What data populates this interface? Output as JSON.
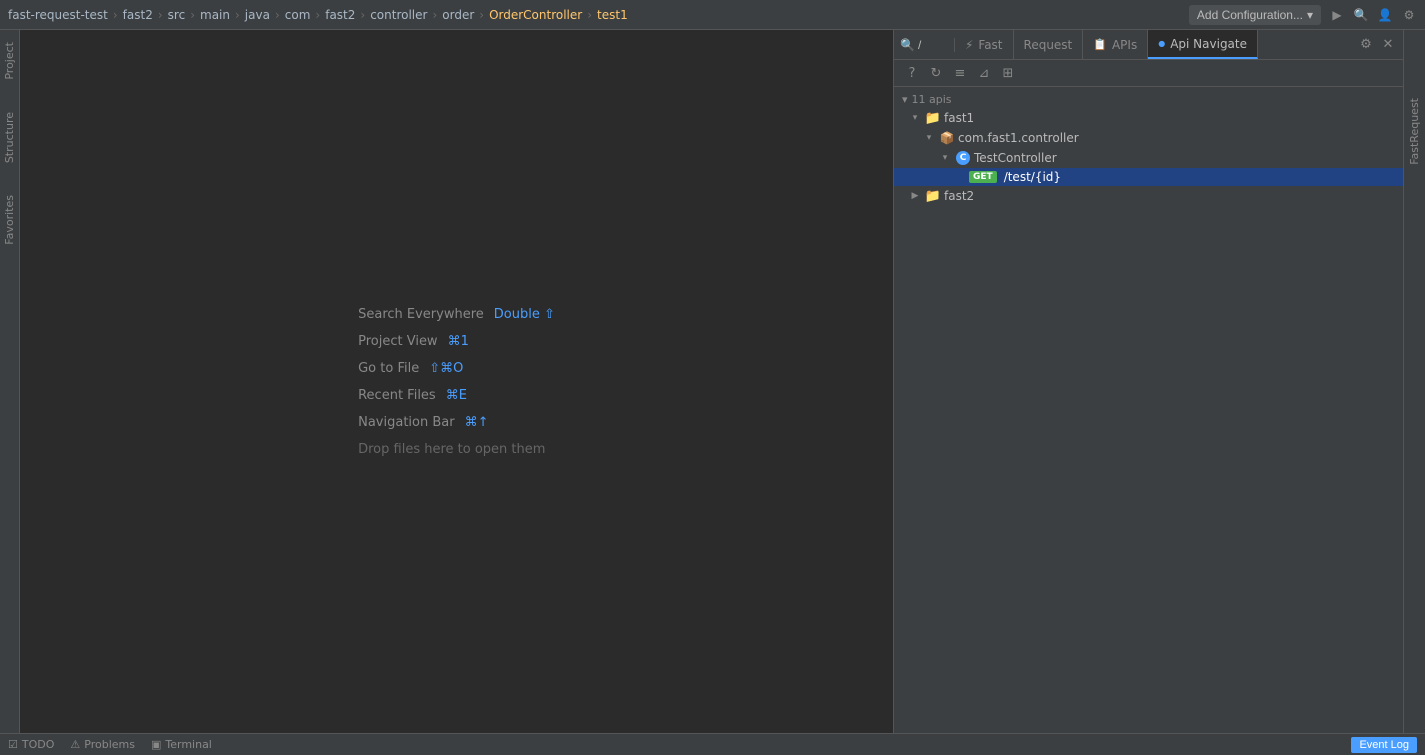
{
  "topbar": {
    "breadcrumb": [
      {
        "label": "fast-request-test",
        "type": "project"
      },
      {
        "label": "fast2",
        "type": "module"
      },
      {
        "label": "src",
        "type": "folder"
      },
      {
        "label": "main",
        "type": "folder"
      },
      {
        "label": "java",
        "type": "folder"
      },
      {
        "label": "com",
        "type": "folder"
      },
      {
        "label": "fast2",
        "type": "folder"
      },
      {
        "label": "controller",
        "type": "folder"
      },
      {
        "label": "order",
        "type": "folder"
      },
      {
        "label": "OrderController",
        "type": "class"
      },
      {
        "label": "test1",
        "type": "method"
      }
    ],
    "add_config_label": "Add Configuration...",
    "run_icon": "▶",
    "search_icon": "🔍",
    "settings_icon": "⚙"
  },
  "editor": {
    "hint_search_label": "Search Everywhere",
    "hint_search_shortcut": "Double ⇧",
    "hint_project_label": "Project View",
    "hint_project_shortcut": "⌘1",
    "hint_goto_label": "Go to File",
    "hint_goto_shortcut": "⇧⌘O",
    "hint_recent_label": "Recent Files",
    "hint_recent_shortcut": "⌘E",
    "hint_navbar_label": "Navigation Bar",
    "hint_navbar_shortcut": "⌘↑",
    "hint_drop": "Drop files here to open them"
  },
  "right_panel": {
    "search_placeholder": "/",
    "tabs": [
      {
        "id": "fast",
        "label": "Fast",
        "icon": "⚡",
        "active": false
      },
      {
        "id": "request",
        "label": "Request",
        "icon": null,
        "active": false
      },
      {
        "id": "apis",
        "label": "APIs",
        "icon": "📋",
        "active": false
      },
      {
        "id": "api_navigate",
        "label": "Api Navigate",
        "icon": "●",
        "active": true
      }
    ],
    "tree": {
      "root_label": "11 apis",
      "items": [
        {
          "id": "fast1",
          "label": "fast1",
          "type": "folder",
          "expanded": true,
          "indent": 1,
          "children": [
            {
              "id": "com_fast1_controller",
              "label": "com.fast1.controller",
              "type": "package",
              "expanded": true,
              "indent": 2,
              "children": [
                {
                  "id": "TestController",
                  "label": "TestController",
                  "type": "class",
                  "expanded": true,
                  "indent": 3,
                  "children": [
                    {
                      "id": "test_get",
                      "method": "GET",
                      "path": "/test/{id}",
                      "indent": 4,
                      "selected": true
                    }
                  ]
                }
              ]
            }
          ]
        },
        {
          "id": "fast2",
          "label": "fast2",
          "type": "folder",
          "expanded": false,
          "indent": 1
        }
      ]
    }
  },
  "status_bar": {
    "todo_label": "TODO",
    "problems_label": "Problems",
    "terminal_label": "Terminal",
    "event_log_label": "Event Log"
  },
  "left_sidebar": {
    "items": [
      {
        "id": "project",
        "label": "Project"
      },
      {
        "id": "structure",
        "label": "Structure"
      },
      {
        "id": "favorites",
        "label": "Favorites"
      }
    ]
  },
  "right_edge": {
    "label": "FastRequest"
  }
}
